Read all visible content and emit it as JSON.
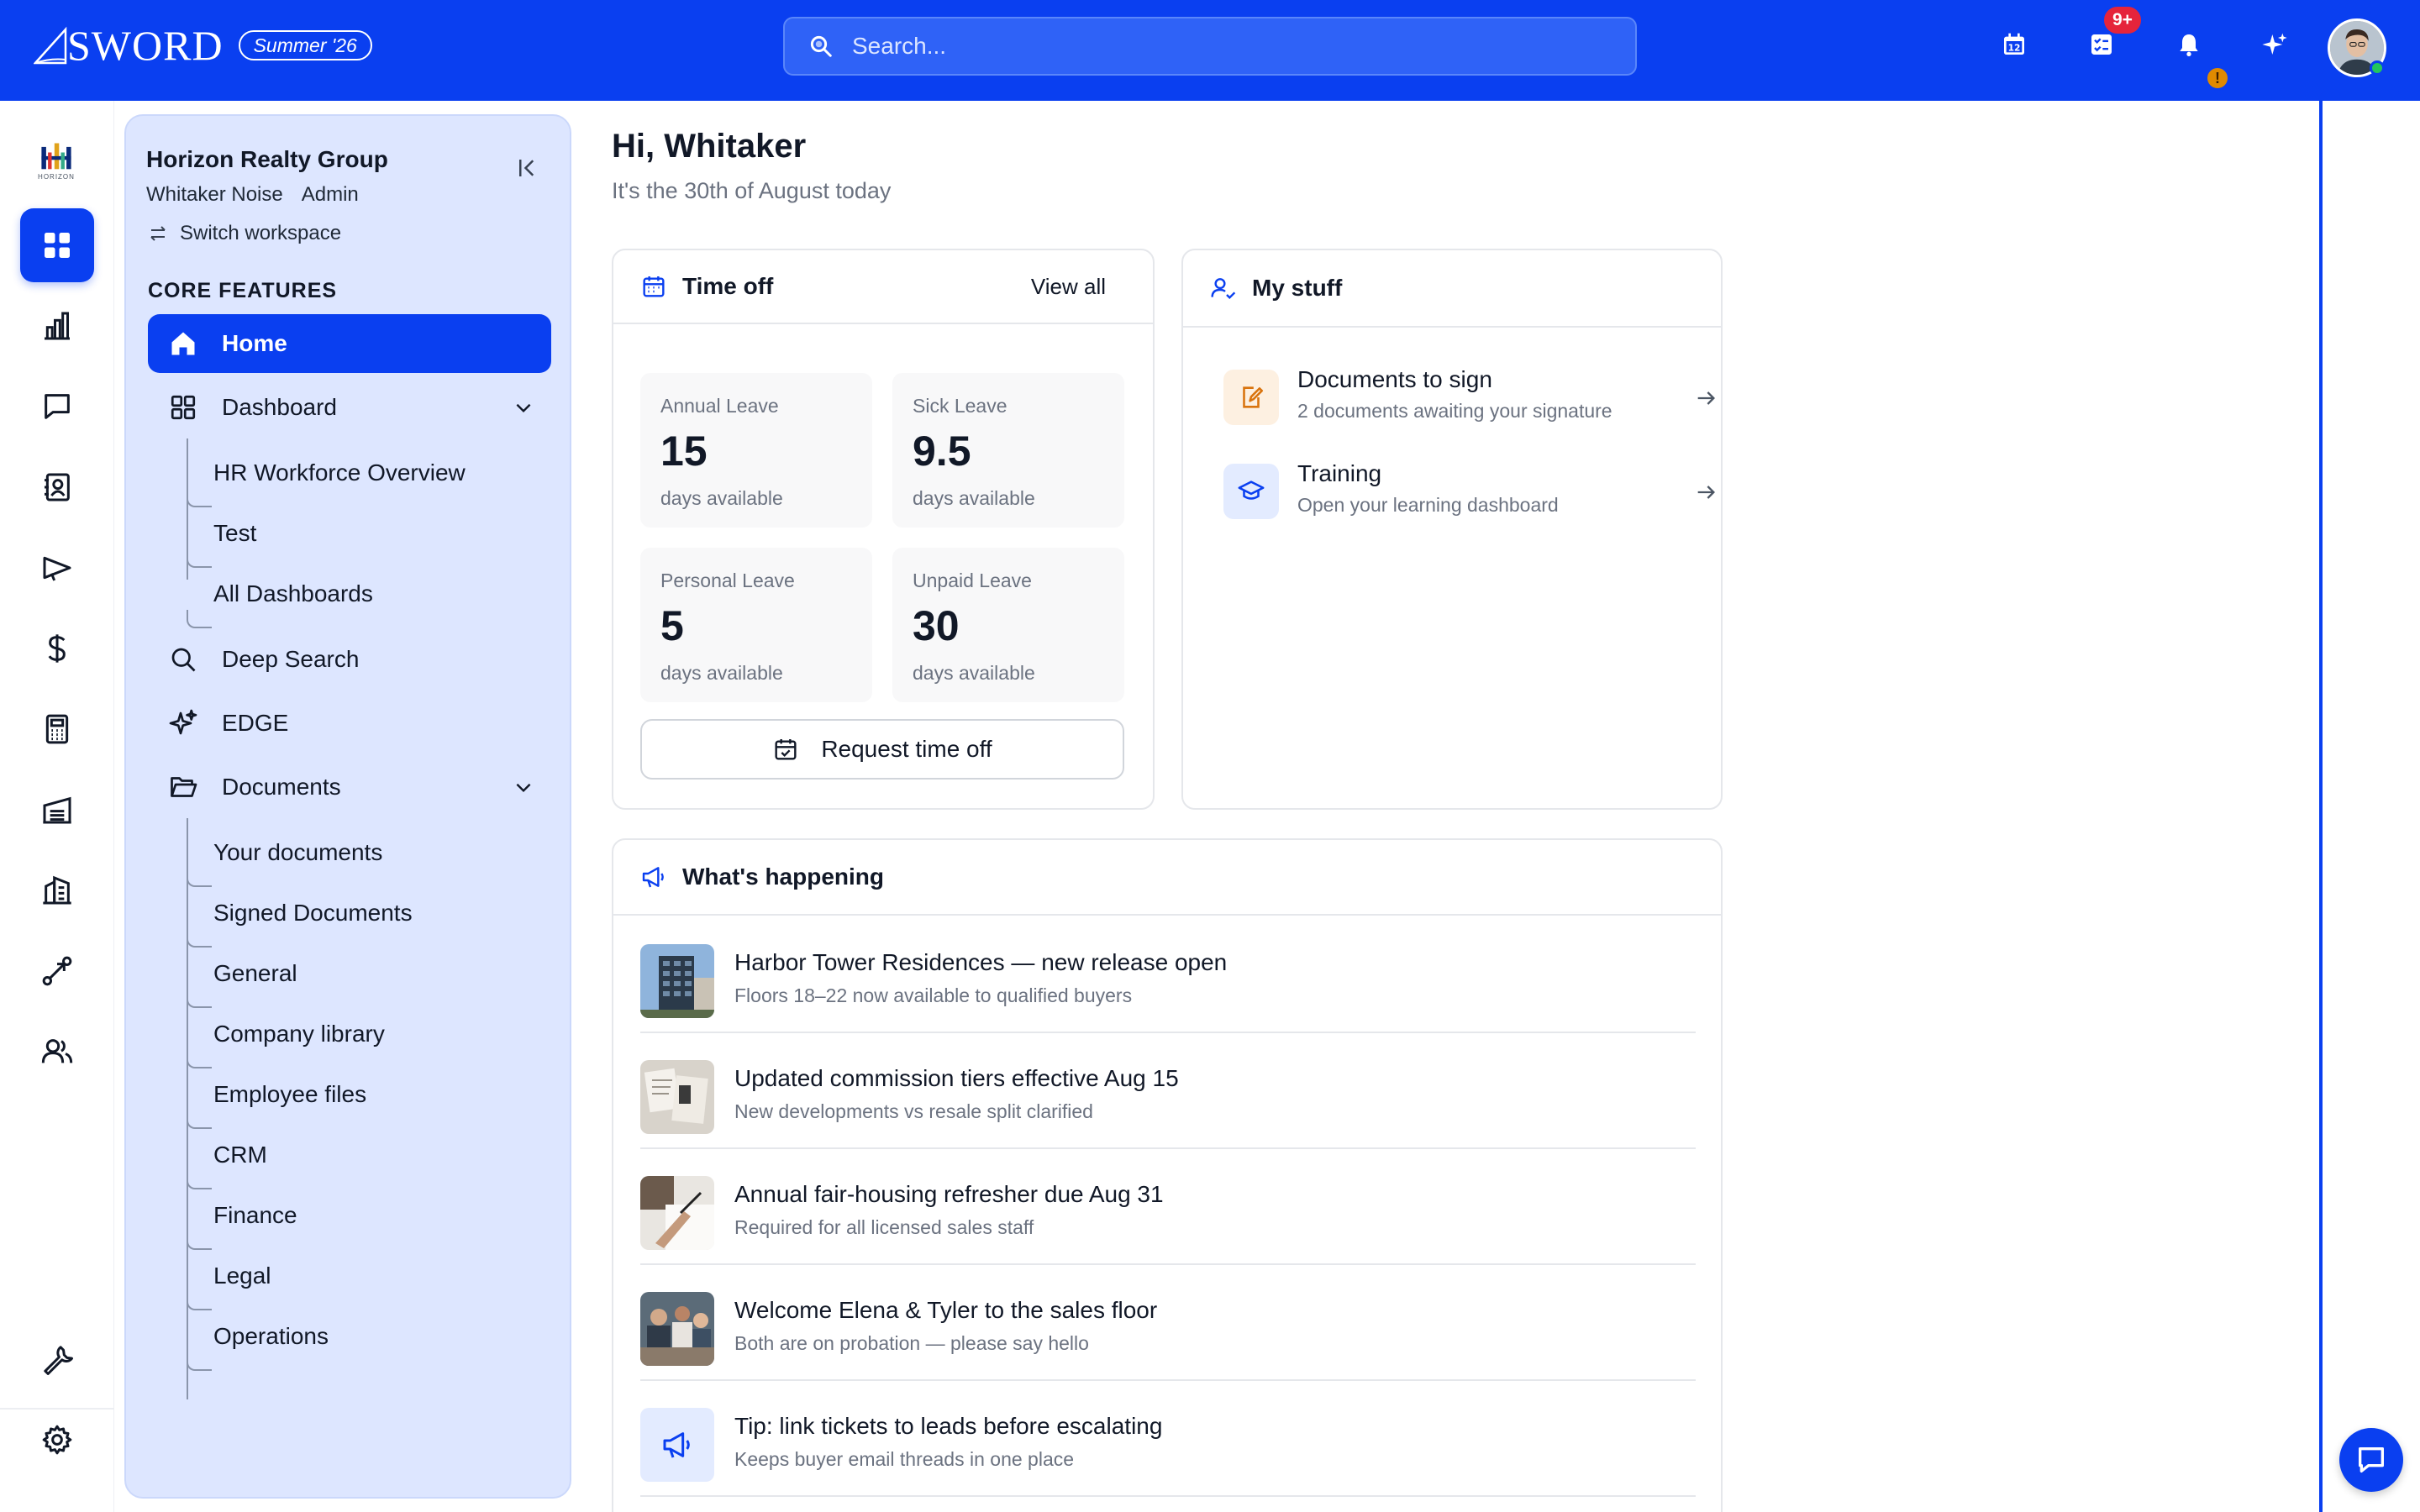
{
  "brand": {
    "name": "SWORD",
    "release": "Summer '26"
  },
  "search": {
    "placeholder": "Search..."
  },
  "header": {
    "notification_count": "9+",
    "alert_mark": "!"
  },
  "rail": {
    "logo_text": "HORIZON"
  },
  "workspace": {
    "name": "Horizon Realty Group",
    "user": "Whitaker Noise",
    "role": "Admin",
    "switch_label": "Switch workspace"
  },
  "sidebar": {
    "section_label": "CORE FEATURES",
    "home": "Home",
    "dashboard": "Dashboard",
    "dashboard_children": [
      "HR Workforce Overview",
      "Test",
      "All Dashboards"
    ],
    "deep_search": "Deep Search",
    "edge": "EDGE",
    "documents": "Documents",
    "documents_children": [
      "Your documents",
      "Signed Documents",
      "General",
      "Company library",
      "Employee files",
      "CRM",
      "Finance",
      "Legal",
      "Operations"
    ]
  },
  "main": {
    "greeting": "Hi, Whitaker",
    "date_line": "It's the 30th of August today"
  },
  "time_off": {
    "title": "Time off",
    "view_all": "View all",
    "tiles": [
      {
        "label": "Annual Leave",
        "value": "15",
        "unit": "days available"
      },
      {
        "label": "Sick Leave",
        "value": "9.5",
        "unit": "days available"
      },
      {
        "label": "Personal Leave",
        "value": "5",
        "unit": "days available"
      },
      {
        "label": "Unpaid Leave",
        "value": "30",
        "unit": "days available"
      }
    ],
    "request_label": "Request time off"
  },
  "my_stuff": {
    "title": "My stuff",
    "items": [
      {
        "title": "Documents to sign",
        "subtitle": "2 documents awaiting your signature"
      },
      {
        "title": "Training",
        "subtitle": "Open your learning dashboard"
      }
    ]
  },
  "whats_happening": {
    "title": "What's happening",
    "items": [
      {
        "title": "Harbor Tower Residences — new release open",
        "subtitle": "Floors 18–22 now available to qualified buyers"
      },
      {
        "title": "Updated commission tiers effective Aug 15",
        "subtitle": "New developments vs resale split clarified"
      },
      {
        "title": "Annual fair-housing refresher due Aug 31",
        "subtitle": "Required for all licensed sales staff"
      },
      {
        "title": "Welcome Elena & Tyler to the sales floor",
        "subtitle": "Both are on probation — please say hello"
      },
      {
        "title": "Tip: link tickets to leads before escalating",
        "subtitle": "Keeps buyer email threads in one place"
      }
    ]
  },
  "colors": {
    "primary": "#0a3ff0",
    "sidebar_bg": "#dde6ff",
    "badge_red": "#e5243b",
    "alert_amber": "#e08a00"
  }
}
